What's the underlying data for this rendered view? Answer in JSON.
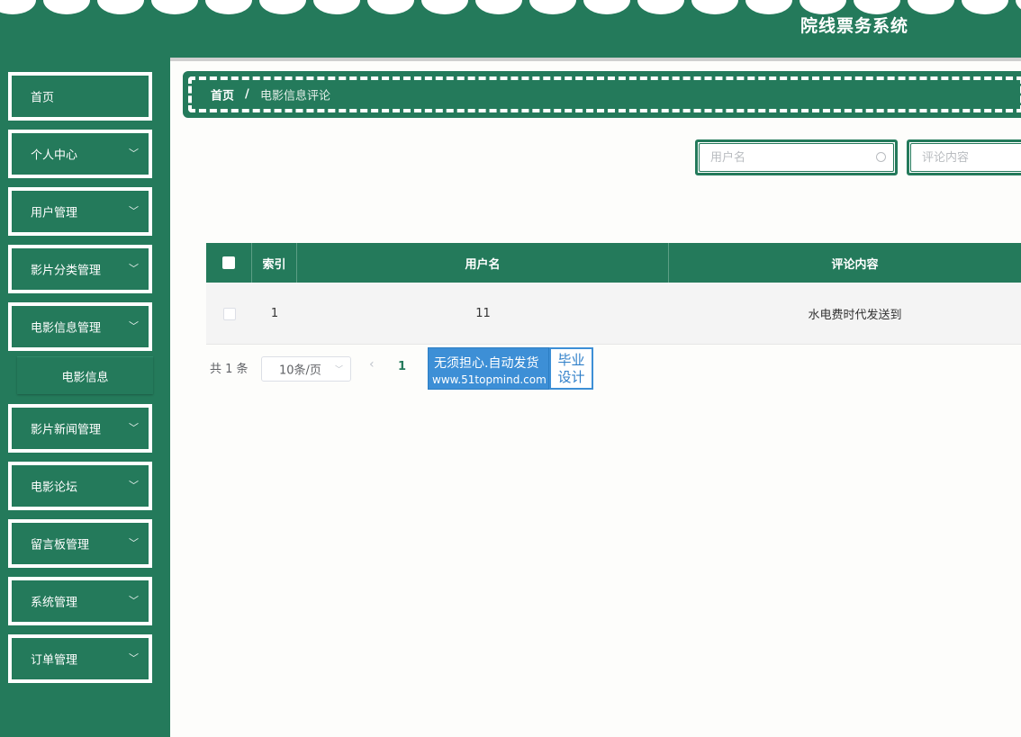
{
  "header": {
    "title": "院线票务系统"
  },
  "sidebar": {
    "items": [
      {
        "label": "首页",
        "has_children": false
      },
      {
        "label": "个人中心",
        "has_children": true
      },
      {
        "label": "用户管理",
        "has_children": true
      },
      {
        "label": "影片分类管理",
        "has_children": true
      },
      {
        "label": "电影信息管理",
        "has_children": true,
        "expanded": true
      },
      {
        "label": "影片新闻管理",
        "has_children": true
      },
      {
        "label": "电影论坛",
        "has_children": true
      },
      {
        "label": "留言板管理",
        "has_children": true
      },
      {
        "label": "系统管理",
        "has_children": true
      },
      {
        "label": "订单管理",
        "has_children": true
      }
    ],
    "sub_item": {
      "label": "电影信息"
    }
  },
  "breadcrumb": {
    "home": "首页",
    "separator": "/",
    "current": "电影信息评论"
  },
  "search": {
    "username_placeholder": "用户名",
    "comment_placeholder": "评论内容"
  },
  "table": {
    "columns": [
      "索引",
      "用户名",
      "评论内容"
    ],
    "rows": [
      {
        "index": "1",
        "username": "11",
        "comment": "水电费时代发送到"
      }
    ]
  },
  "pagination": {
    "total_text": "共 1 条",
    "page_size": "10条/页",
    "current_page": "1"
  },
  "watermark": {
    "line1": "无须担心.自动发货",
    "line2": "www.51topmind.com",
    "right_line1": "毕业",
    "right_line2": "设计"
  },
  "colors": {
    "primary": "#247a5b",
    "accent_blue": "#3d8fd6"
  }
}
